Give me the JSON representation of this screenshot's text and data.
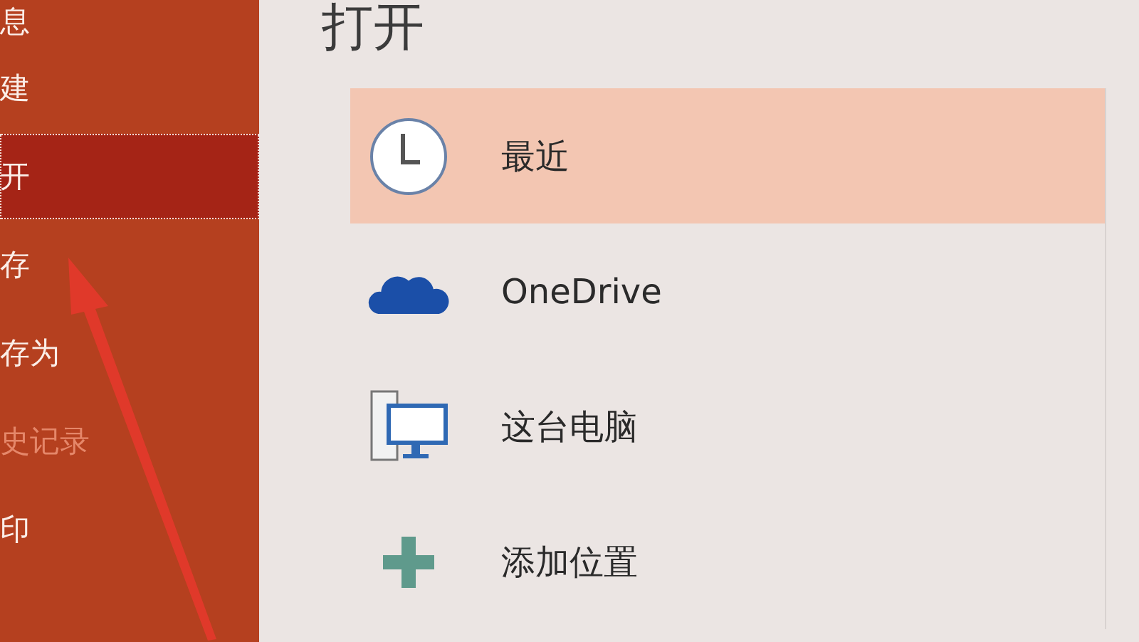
{
  "sidebar": {
    "items": [
      {
        "label": "息",
        "selected": false,
        "disabled": false
      },
      {
        "label": "建",
        "selected": false,
        "disabled": false
      },
      {
        "label": "开",
        "selected": true,
        "disabled": false
      },
      {
        "label": "存",
        "selected": false,
        "disabled": false
      },
      {
        "label": "存为",
        "selected": false,
        "disabled": false
      },
      {
        "label": "史记录",
        "selected": false,
        "disabled": true
      },
      {
        "label": "印",
        "selected": false,
        "disabled": false
      }
    ]
  },
  "page": {
    "title": "打开"
  },
  "locations": [
    {
      "kind": "recent",
      "label": "最近",
      "selected": true
    },
    {
      "kind": "cloud",
      "label": "OneDrive",
      "selected": false
    },
    {
      "kind": "computer",
      "label": "这台电脑",
      "selected": false
    },
    {
      "kind": "add",
      "label": "添加位置",
      "selected": false
    }
  ]
}
